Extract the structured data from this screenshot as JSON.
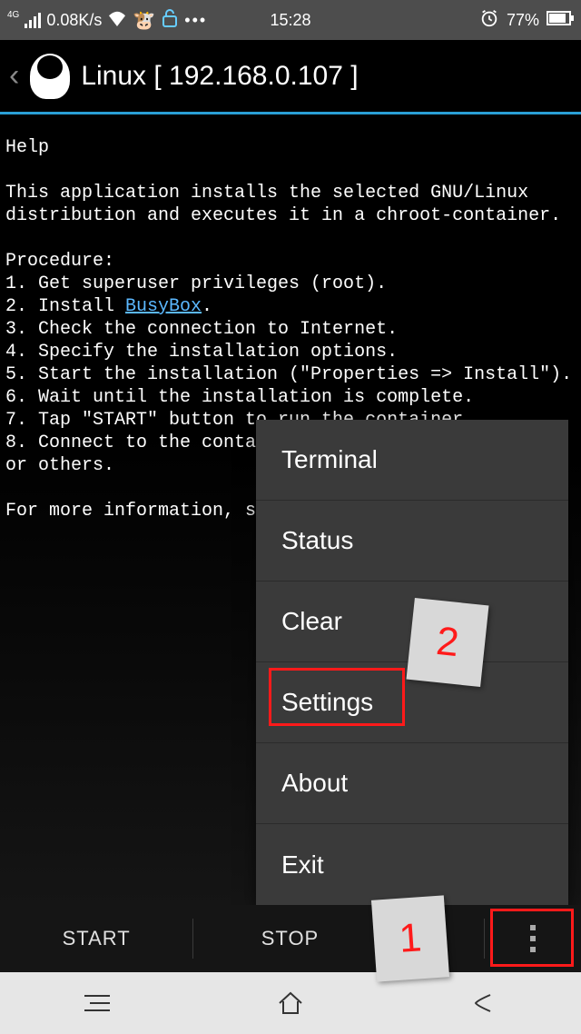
{
  "statusbar": {
    "network_label": "4G",
    "speed": "0.08K/s",
    "time": "15:28",
    "battery": "77%"
  },
  "header": {
    "title": "Linux  [ 192.168.0.107 ]"
  },
  "help": {
    "heading": "Help",
    "intro": "This application installs the selected GNU/Linux distribution and executes it in a chroot-container.",
    "procedure_label": "Procedure:",
    "steps": [
      "1. Get superuser privileges (root).",
      "2. Install ",
      "3. Check the connection to Internet.",
      "4. Specify the installation options.",
      "5. Start the installation (\"Properties => Install\").",
      "6. Wait until the installation is complete.",
      "7. Tap \"START\" button to run the container.",
      "8. Connect to the container through CLI, SSH, VNC, or others."
    ],
    "busybox_link": "BusyBox",
    "more_info": "For more information, see"
  },
  "menu": {
    "items": [
      "Terminal",
      "Status",
      "Clear",
      "Settings",
      "About",
      "Exit"
    ]
  },
  "bottombar": {
    "start": "START",
    "stop": "STOP"
  },
  "annotations": {
    "label1": "1",
    "label2": "2"
  }
}
